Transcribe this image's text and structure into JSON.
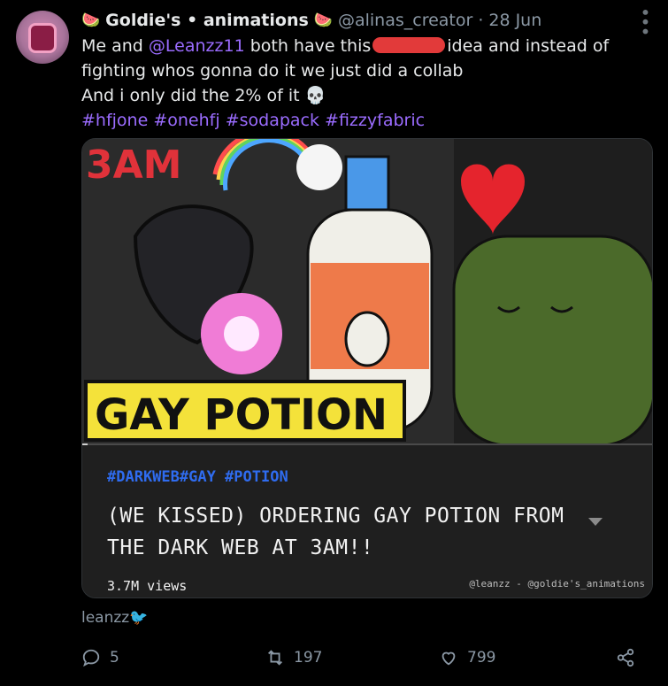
{
  "tweet": {
    "display_name": "Goldie's • animations",
    "emoji": "🍉",
    "handle": "@alinas_creator",
    "separator": "·",
    "date": "28 Jun",
    "line1_pre": "Me and ",
    "mention": "@Leanzz11",
    "line1_mid": " both have this",
    "line1_post": "idea and instead of",
    "line2": "fighting whos gonna do it we just did a collab",
    "line3": "And i only did the 2% of it ",
    "skull": "💀",
    "hashtags": [
      "#hfjone",
      "#onehfj",
      "#sodapack",
      "#fizzyfabric"
    ]
  },
  "video": {
    "thumbnail_title": "GAY POTION",
    "thumbnail_corner": "3AM",
    "hashtags": "#DARKWEB#GAY #POTION",
    "title": "(WE KISSED) ORDERING GAY POTION FROM THE DARK WEB AT 3AM!!",
    "views": "3.7M views",
    "credit": "@leanzz - @goldie's_animations",
    "progress": 0.01
  },
  "footnote": {
    "text": "leanzz",
    "bird": "🐦"
  },
  "actions": {
    "replies": "5",
    "reposts": "197",
    "likes": "799"
  },
  "colors": {
    "accent": "#9b6cff",
    "muted": "#8b98a5",
    "video_hashtag": "#2f6cf0",
    "thumbnail_banner": "#f4e23a"
  }
}
